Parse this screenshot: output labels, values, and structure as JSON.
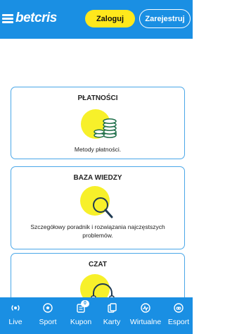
{
  "header": {
    "logo": "betcris",
    "login_label": "Zaloguj",
    "register_label": "Zarejestruj"
  },
  "cards": [
    {
      "title": "PŁATNOŚCI",
      "description": "Metody płatności.",
      "icon": "coins-icon"
    },
    {
      "title": "BAZA WIEDZY",
      "description": "Szczegółowy poradnik i rozwiązania najczęstszych problemów.",
      "icon": "magnifier-icon"
    },
    {
      "title": "CZAT",
      "description": "",
      "icon": "headset-icon"
    }
  ],
  "bottom_nav": [
    {
      "label": "Live",
      "icon": "live-icon"
    },
    {
      "label": "Sport",
      "icon": "soccer-ball-icon"
    },
    {
      "label": "Kupon",
      "icon": "coupon-icon",
      "badge": "0"
    },
    {
      "label": "Karty",
      "icon": "cards-icon"
    },
    {
      "label": "Wirtualne",
      "icon": "virtual-icon"
    },
    {
      "label": "Esport",
      "icon": "gamepad-icon"
    }
  ],
  "colors": {
    "brand_blue": "#1a8fe3",
    "accent_yellow": "#ffe81c",
    "card_border": "#4aa7e8"
  }
}
